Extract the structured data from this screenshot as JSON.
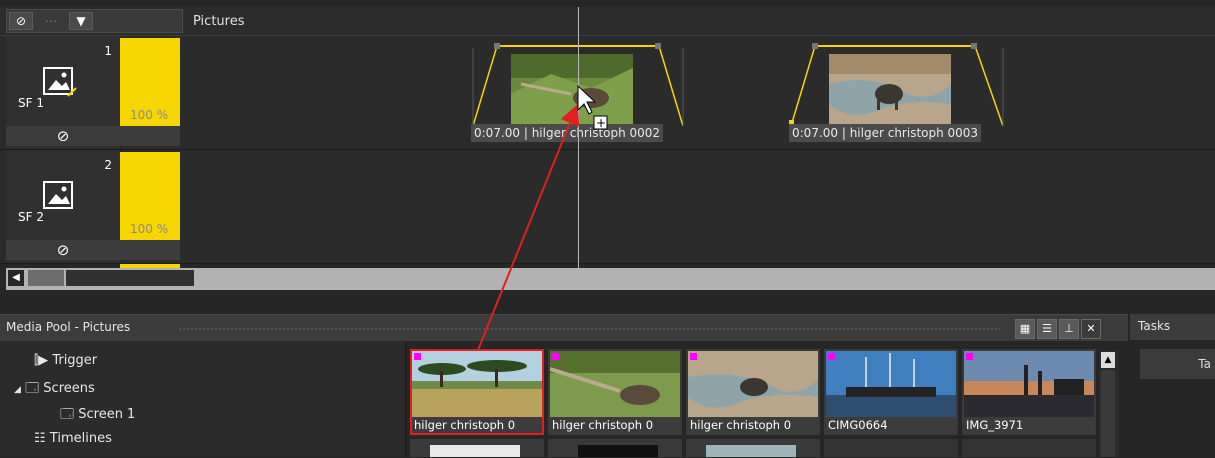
{
  "timeline": {
    "title": "Pictures",
    "tracks": [
      {
        "number": "1",
        "sf_label": "SF  1",
        "opacity": "100 %"
      },
      {
        "number": "2",
        "sf_label": "SF  2",
        "opacity": "100 %"
      }
    ],
    "clips": [
      {
        "label": "0:07.00 | hilger christoph 0002"
      },
      {
        "label": "0:07.00 | hilger christoph 0003"
      }
    ]
  },
  "media_pool": {
    "title": "Media Pool - Pictures",
    "tree": {
      "items": [
        {
          "label": "Trigger",
          "icon": "trigger-icon"
        },
        {
          "label": "Screens",
          "icon": "screens-icon"
        },
        {
          "label": "Screen 1",
          "icon": "screen-icon"
        },
        {
          "label": "Timelines",
          "icon": "timelines-icon"
        }
      ]
    },
    "thumbnails": [
      {
        "caption": "hilger christoph 0"
      },
      {
        "caption": "hilger christoph 0"
      },
      {
        "caption": "hilger christoph 0"
      },
      {
        "caption": "CIMG0664"
      },
      {
        "caption": "IMG_3971"
      }
    ]
  },
  "tasks": {
    "title": "Tasks",
    "tab": "Ta"
  },
  "colors": {
    "accent_yellow": "#f7d500",
    "selection_red": "#e02020",
    "drag_arrow": "#e02020"
  }
}
